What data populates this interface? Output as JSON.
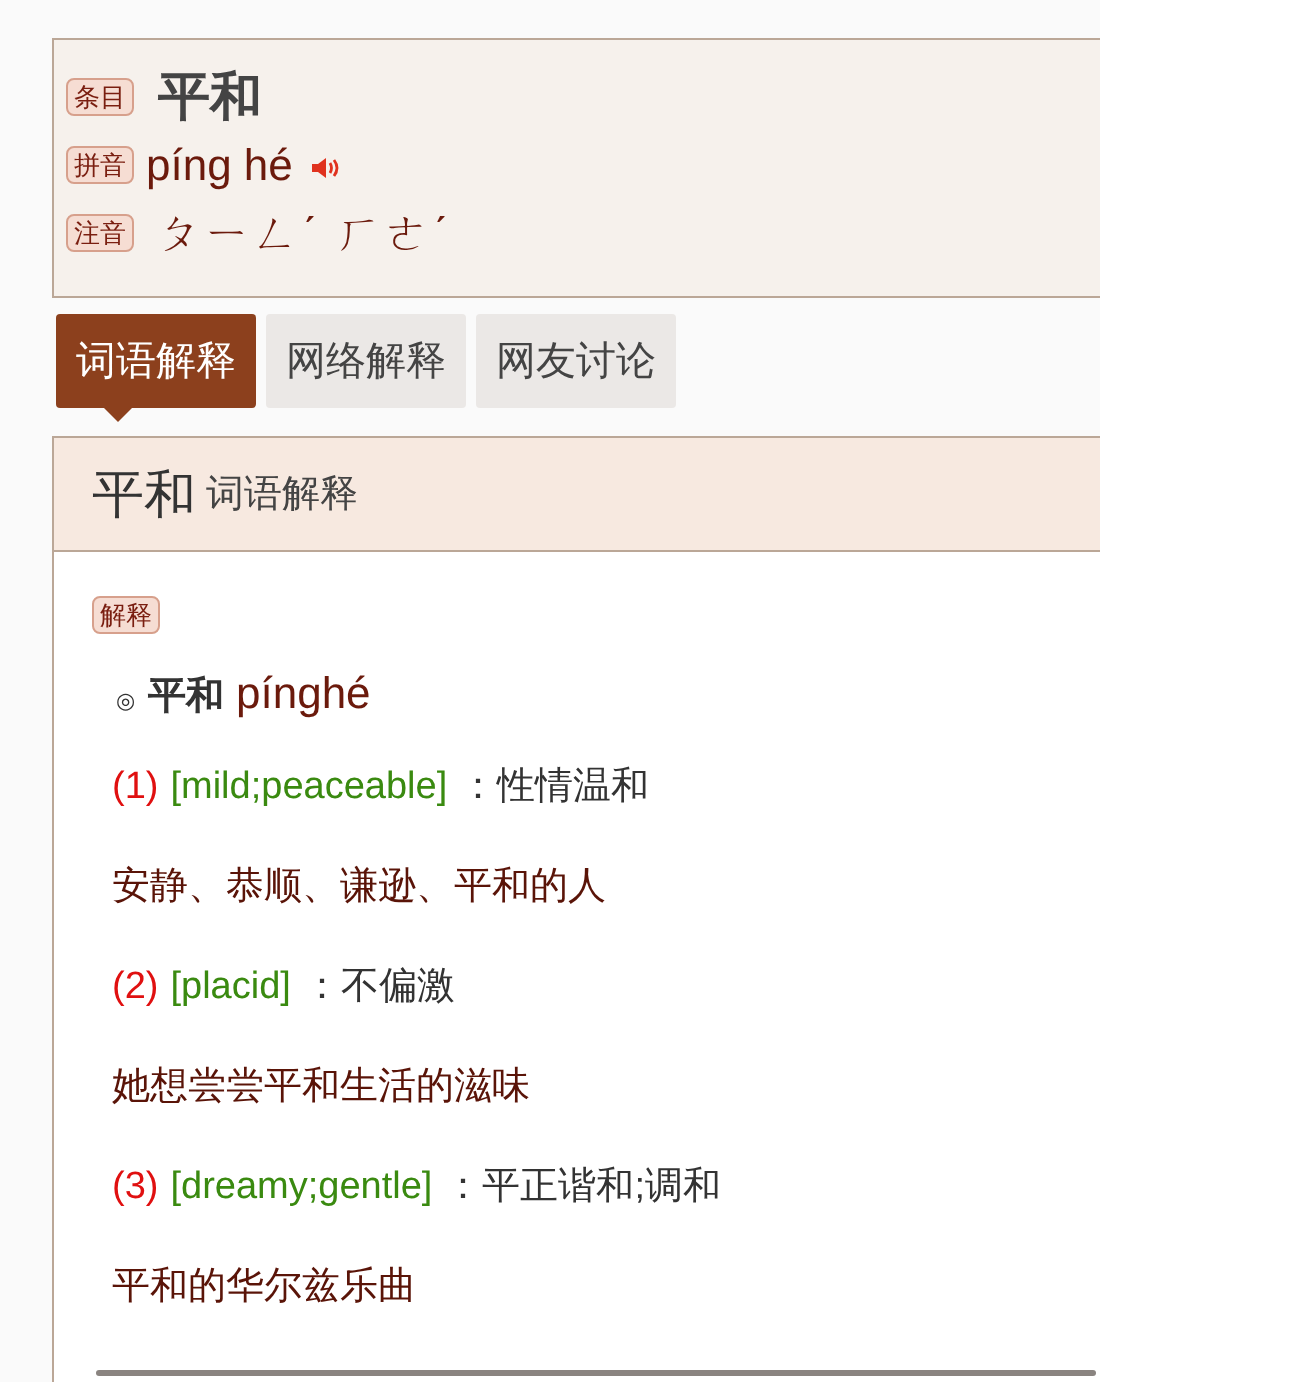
{
  "entry": {
    "rows": [
      {
        "kind": "word",
        "tag": "条目",
        "text": "平和"
      },
      {
        "kind": "pinyin",
        "tag": "拼音",
        "text": "píng hé"
      },
      {
        "kind": "zhuyin",
        "tag": "注音",
        "text": "ㄆㄧㄥˊ ㄏㄜˊ"
      }
    ]
  },
  "tabs": [
    {
      "label": "词语解释",
      "selected": true
    },
    {
      "label": "网络解释",
      "selected": false
    },
    {
      "label": "网友讨论",
      "selected": false
    }
  ],
  "section": {
    "title": "平和",
    "subtitle": "词语解释"
  },
  "definition": {
    "tag": "解释",
    "bullet": "◎",
    "word": "平和",
    "pinyin": "pínghé",
    "lines": [
      {
        "kind": "sense",
        "number": "(1)",
        "english": "[mild;peaceable]",
        "meaning": "：性情温和"
      },
      {
        "kind": "example",
        "text": "安静、恭顺、谦逊、平和的人"
      },
      {
        "kind": "sense",
        "number": "(2)",
        "english": "[placid]",
        "meaning": "：不偏激"
      },
      {
        "kind": "example",
        "text": "她想尝尝平和生活的滋味"
      },
      {
        "kind": "sense",
        "number": "(3)",
        "english": "[dreamy;gentle]",
        "meaning": "：平正谐和;调和"
      },
      {
        "kind": "example",
        "text": "平和的华尔兹乐曲"
      }
    ]
  }
}
